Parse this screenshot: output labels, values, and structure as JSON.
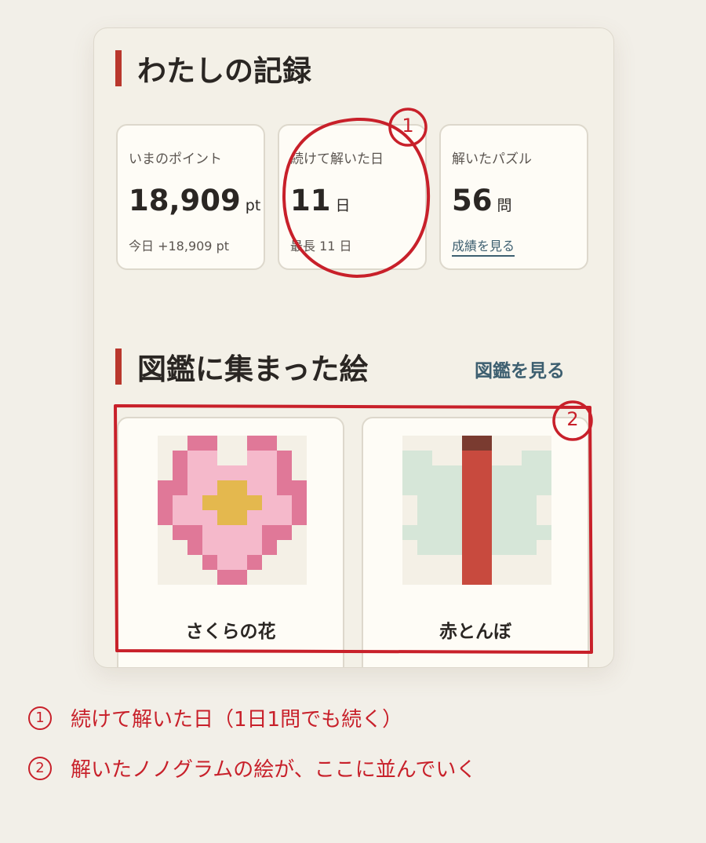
{
  "records": {
    "title": "わたしの記録",
    "stats": [
      {
        "label": "いまのポイント",
        "value": "18,909",
        "unit": "pt",
        "sub": "今日 +18,909 pt"
      },
      {
        "label": "続けて解いた日",
        "value": "11",
        "unit": "日",
        "sub": "最長 11 日"
      },
      {
        "label": "解いたパズル",
        "value": "56",
        "unit": "問",
        "link": "成績を見る"
      }
    ]
  },
  "gallery": {
    "title": "図鑑に集まった絵",
    "link": "図鑑を見る",
    "items": [
      {
        "name": "さくらの花",
        "icon": "sakura-pixel-icon"
      },
      {
        "name": "赤とんぼ",
        "icon": "dragonfly-pixel-icon"
      }
    ]
  },
  "annotations": {
    "marker1": "1",
    "marker2": "2",
    "notes": [
      {
        "num": "1",
        "text": "続けて解いた日（1日1問でも続く）"
      },
      {
        "num": "2",
        "text": "解いたノノグラムの絵が、ここに並んでいく"
      }
    ],
    "color": "#c8202a"
  },
  "colors": {
    "accent_bar": "#b9372d",
    "link": "#3d5f70"
  }
}
